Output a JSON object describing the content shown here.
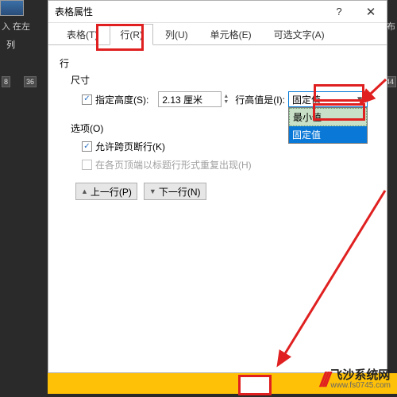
{
  "background": {
    "insert_text": "入 在左",
    "column_text": "列",
    "split_text": "分布",
    "ruler_marks": [
      "8",
      "36",
      "44"
    ]
  },
  "dialog": {
    "title": "表格属性",
    "help": "?",
    "close": "✕",
    "tabs": {
      "table": "表格(T)",
      "row": "行(R)",
      "column": "列(U)",
      "cell": "单元格(E)",
      "alttext": "可选文字(A)"
    },
    "body": {
      "row_label": "行",
      "size_label": "尺寸",
      "specify_height": "指定高度(S):",
      "height_value": "2.13 厘米",
      "row_height_is": "行高值是(I):",
      "rowheight_selected": "固定值",
      "dropdown": {
        "opt1": "最小值",
        "opt2": "固定值"
      },
      "options_label": "选项(O)",
      "allow_break": "允许跨页断行(K)",
      "repeat_header": "在各页顶端以标题行形式重复出现(H)",
      "prev_row": "上一行(P)",
      "next_row": "下一行(N)"
    }
  },
  "watermark": {
    "symbol": "///",
    "line1": "飞沙系统网",
    "line2": "www.fs0745.com"
  }
}
